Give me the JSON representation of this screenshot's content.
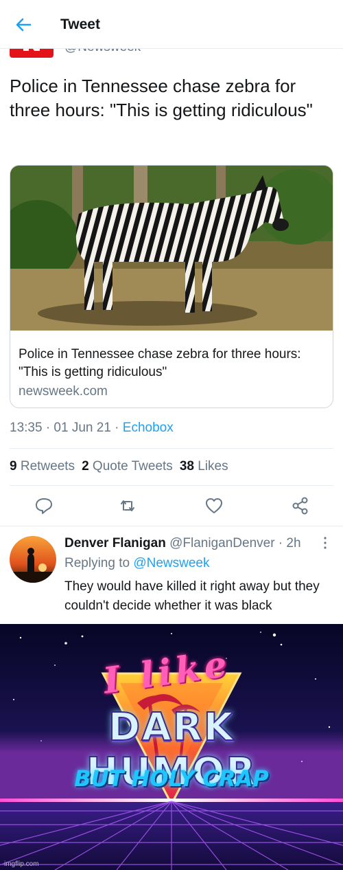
{
  "header": {
    "title": "Tweet"
  },
  "tweet": {
    "handle": "@Newsweek",
    "text": "Police in Tennessee chase zebra for three hours: \"This is getting ridiculous\"",
    "card": {
      "title": "Police in Tennessee chase zebra for three hours: \"This is getting ridiculous\"",
      "domain": "newsweek.com"
    },
    "time": "13:35 · 01 Jun 21 · ",
    "source": "Echobox",
    "stats": {
      "retweets_count": "9",
      "retweets_label": "Retweets",
      "quotes_count": "2",
      "quotes_label": "Quote Tweets",
      "likes_count": "38",
      "likes_label": "Likes"
    }
  },
  "reply": {
    "name": "Denver Flanigan",
    "handle": "@FlaniganDenver · 2h",
    "replying_label": "Replying to ",
    "replying_to": "@Newsweek",
    "text": "They would have killed it right away but they couldn't decide whether it was black"
  },
  "meme": {
    "line1": "I like",
    "line2": "DARK HUMOR",
    "line3": "BUT HOLY CRAP"
  },
  "watermark": "imgflip.com",
  "colors": {
    "link": "#1da1f2",
    "muted": "#657786",
    "text": "#14171a"
  }
}
